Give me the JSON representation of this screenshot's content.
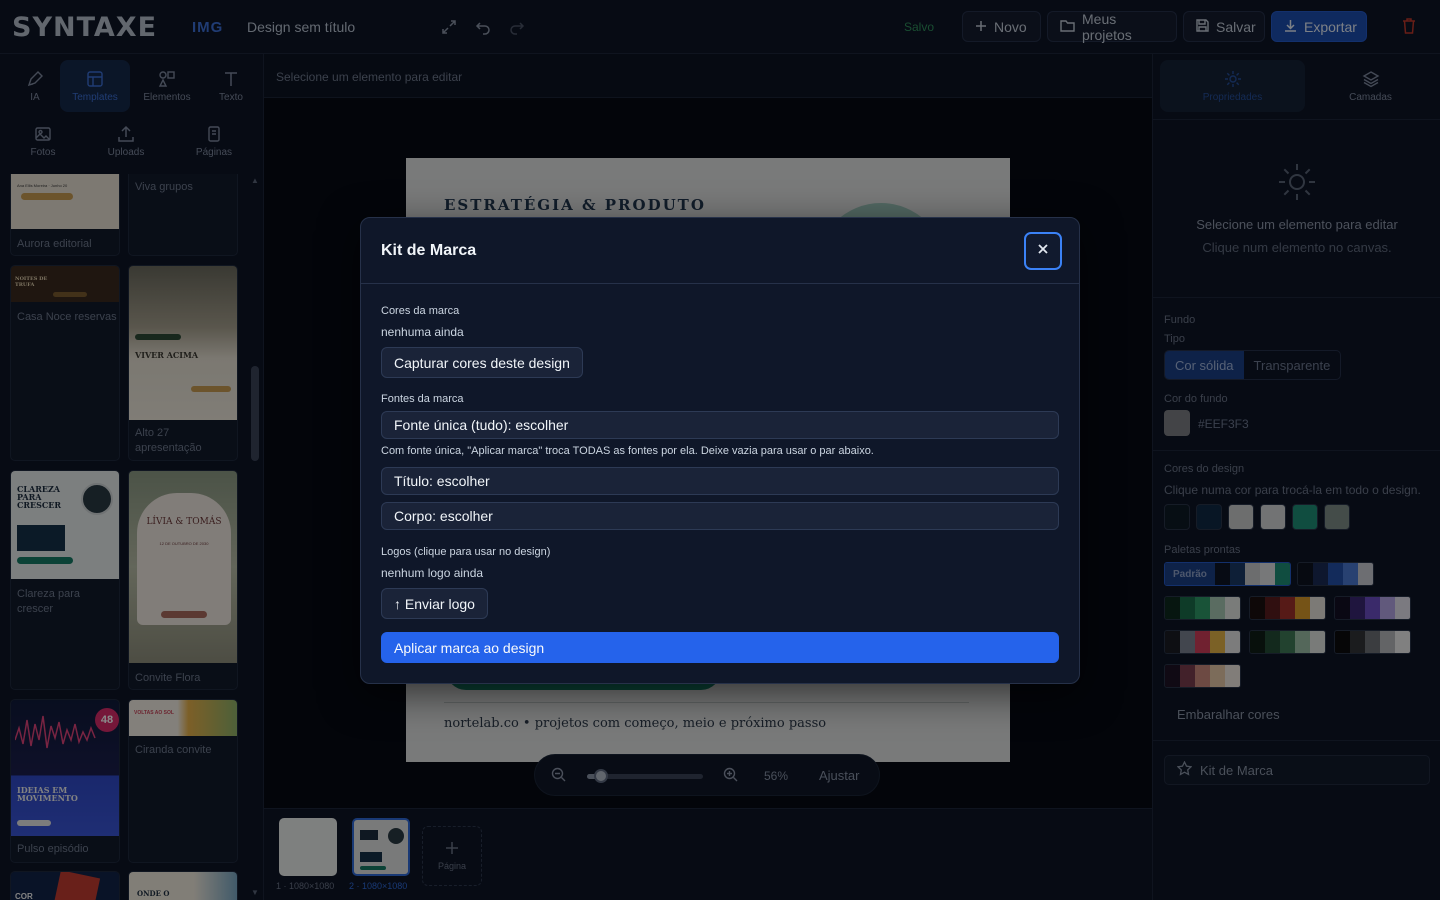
{
  "app": {
    "logo": "SYNTAXE",
    "logo_sub": "IMG",
    "doc_title": "Design sem título",
    "status": "Salvo"
  },
  "toolbar": {
    "new_label": "Novo",
    "projects_label": "Meus projetos",
    "save_label": "Salvar",
    "export_label": "Exportar"
  },
  "left_nav": {
    "ia": "IA",
    "templates": "Templates",
    "elements": "Elementos",
    "text": "Texto",
    "photos": "Fotos",
    "uploads": "Uploads",
    "pages": "Páginas"
  },
  "templates": {
    "aurora": {
      "caption": "Aurora editorial",
      "thumb_line": "Ana Ellis Moreira · Junho 20"
    },
    "viva": {
      "caption": "Viva grupos"
    },
    "casa": {
      "caption": "Casa Noce reservas",
      "thumb_text": "NOITES DE TRUFA"
    },
    "alto": {
      "caption": "Alto 27 apresentação",
      "thumb_text": "VIVER ACIMA"
    },
    "clareza": {
      "caption": "Clareza para crescer",
      "thumb_text": "CLAREZA PARA CRESCER"
    },
    "convite": {
      "caption": "Convite Flora",
      "thumb_text": "LÍVIA & TOMÁS",
      "thumb_date": "12 DE OUTUBRO DE 2030"
    },
    "pulso": {
      "caption": "Pulso episódio",
      "thumb_text": "IDEIAS EM MOVIMENTO",
      "thumb_num": "48"
    },
    "ciranda": {
      "caption": "Ciranda convite",
      "thumb_text": "VOLTAS AO SOL"
    },
    "cor": {
      "thumb_text": "COR"
    },
    "onde": {
      "thumb_text": "ONDE O"
    }
  },
  "center": {
    "hint": "Selecione um elemento para editar",
    "canvas_heading": "ESTRATÉGIA & PRODUTO",
    "canvas_footer": "nortelab.co • projetos com começo, meio e próximo passo",
    "zoom_pct": "56%",
    "zoom_level": 0.12,
    "fit_label": "Ajustar"
  },
  "pages": {
    "p1": "1 · 1080×1080",
    "p2": "2 · 1080×1080",
    "add_label": "Página"
  },
  "right": {
    "tab_props": "Propriedades",
    "tab_layers": "Camadas",
    "empty_title": "Selecione um elemento para editar",
    "empty_sub": "Clique num elemento no canvas.",
    "bg_label": "Fundo",
    "type_label": "Tipo",
    "type_solid": "Cor sólida",
    "type_transparent": "Transparente",
    "bg_color_label": "Cor do fundo",
    "bg_hex": "#EEF3F3",
    "design_colors_label": "Cores do design",
    "design_colors_hint": "Clique numa cor para trocá-la em todo o design.",
    "design_colors": [
      "#0d1b26",
      "#0f2a45",
      "#c9cbcc",
      "#d3d5d6",
      "#1e8f76",
      "#7e8c88"
    ],
    "palettes_label": "Paletas prontas",
    "default_palette": "Padrão",
    "shuffle_label": "Embaralhar cores",
    "kit_label": "Kit de Marca"
  },
  "modal": {
    "title": "Kit de Marca",
    "colors_label": "Cores da marca",
    "colors_empty": "nenhuma ainda",
    "capture_label": "Capturar cores deste design",
    "fonts_label": "Fontes da marca",
    "single_font": "Fonte única (tudo): escolher",
    "font_note": "Com fonte única, \"Aplicar marca\" troca TODAS as fontes por ela. Deixe vazia para usar o par abaixo.",
    "title_font": "Título: escolher",
    "body_font": "Corpo: escolher",
    "logos_label": "Logos (clique para usar no design)",
    "logos_empty": "nenhum logo ainda",
    "upload_label": "↑ Enviar logo",
    "apply_label": "Aplicar marca ao design"
  }
}
